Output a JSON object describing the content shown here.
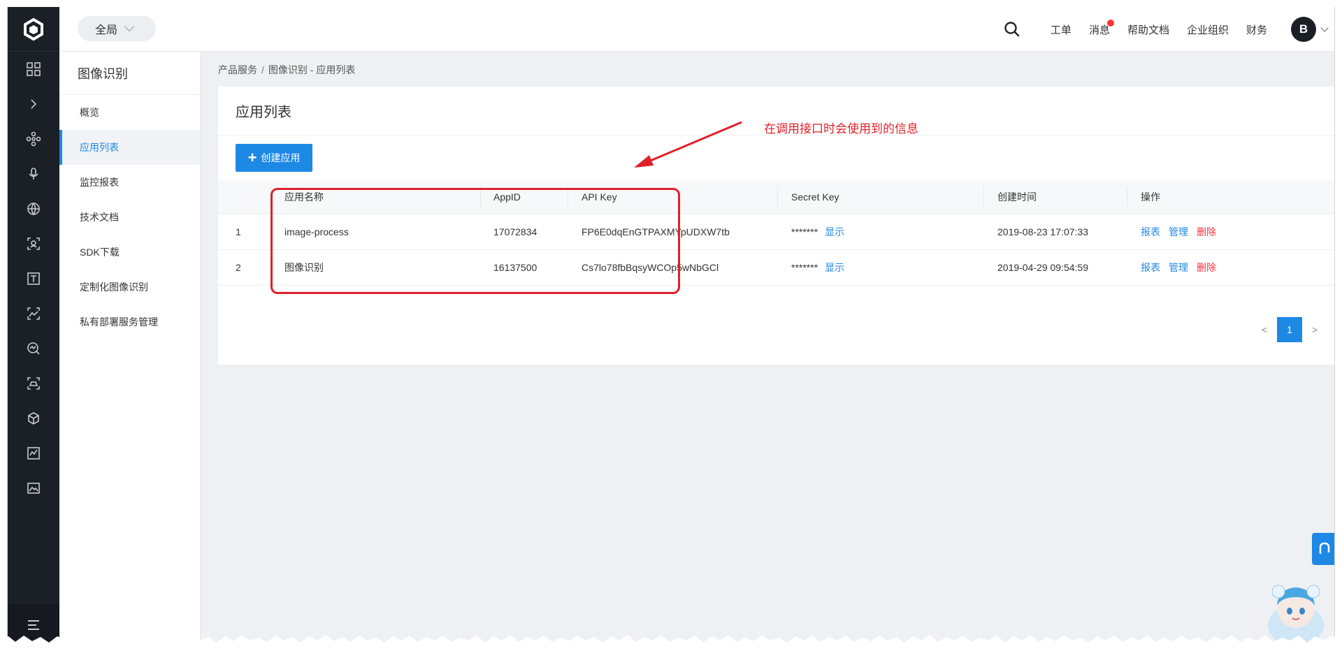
{
  "scope": {
    "label": "全局"
  },
  "topnav": {
    "links": [
      {
        "label": "工单"
      },
      {
        "label": "消息"
      },
      {
        "label": "帮助文档"
      },
      {
        "label": "企业组织"
      },
      {
        "label": "财务"
      }
    ],
    "avatar_letter": "B"
  },
  "sidebar": {
    "title": "图像识别",
    "items": [
      {
        "label": "概览"
      },
      {
        "label": "应用列表"
      },
      {
        "label": "监控报表"
      },
      {
        "label": "技术文档"
      },
      {
        "label": "SDK下载"
      },
      {
        "label": "定制化图像识别"
      },
      {
        "label": "私有部署服务管理"
      }
    ]
  },
  "breadcrumb": {
    "root": "产品服务",
    "sep": "/",
    "current": "图像识别 - 应用列表"
  },
  "page": {
    "title": "应用列表",
    "create_button": "创建应用"
  },
  "table": {
    "headers": {
      "name": "应用名称",
      "appid": "AppID",
      "apikey": "API Key",
      "secret": "Secret Key",
      "created": "创建时间",
      "ops": "操作"
    },
    "rows": [
      {
        "idx": "1",
        "name": "image-process",
        "appid": "17072834",
        "apikey": "FP6E0dqEnGTPAXMYpUDXW7tb",
        "secret": "*******",
        "show": "显示",
        "created": "2019-08-23 17:07:33",
        "op_report": "报表",
        "op_manage": "管理",
        "op_delete": "删除"
      },
      {
        "idx": "2",
        "name": "图像识别",
        "appid": "16137500",
        "apikey": "Cs7lo78fbBqsyWCOp5wNbGCl",
        "secret": "*******",
        "show": "显示",
        "created": "2019-04-29 09:54:59",
        "op_report": "报表",
        "op_manage": "管理",
        "op_delete": "删除"
      }
    ]
  },
  "pagination": {
    "prev": "<",
    "current": "1",
    "next": ">"
  },
  "annotation": {
    "text": "在调用接口时会使用到的信息"
  },
  "colors": {
    "accent": "#1e88e5",
    "danger": "#f5333f",
    "rail": "#1b1f26",
    "annotation": "#e0202a"
  }
}
